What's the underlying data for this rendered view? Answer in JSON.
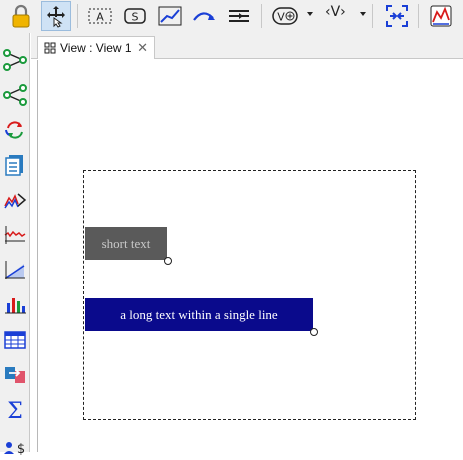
{
  "toolbar": {
    "buttons": [
      {
        "icon": "lock-icon"
      },
      {
        "icon": "move-graphics-icon",
        "active": true
      },
      {
        "icon": "text-box-icon",
        "label": "A"
      },
      {
        "icon": "slider-icon",
        "label": "S"
      },
      {
        "icon": "line-graph-icon"
      },
      {
        "icon": "curved-arrow-icon"
      },
      {
        "icon": "align-lines-icon"
      },
      {
        "icon": "add-variable-icon",
        "label": "V"
      },
      {
        "icon": "variable-brackets-icon",
        "label": "‹V›"
      },
      {
        "icon": "fit-view-icon"
      },
      {
        "icon": "graphics-view-icon"
      }
    ]
  },
  "sidebar": {
    "items": [
      {
        "icon": "graph-icon"
      },
      {
        "icon": "network-icon"
      },
      {
        "icon": "refresh-cycle-icon"
      },
      {
        "icon": "document-list-icon"
      },
      {
        "icon": "histogram-compare-icon"
      },
      {
        "icon": "time-series-icon"
      },
      {
        "icon": "area-chart-icon"
      },
      {
        "icon": "bar-chart-icon"
      },
      {
        "icon": "table-icon"
      },
      {
        "icon": "transfer-icon"
      },
      {
        "icon": "sigma-icon"
      },
      {
        "icon": "user-dollar-icon"
      }
    ]
  },
  "tab": {
    "label": "View : View 1",
    "close": "✕"
  },
  "canvas": {
    "short_text": "short text",
    "long_text": "a long text within a single line"
  },
  "colors": {
    "short_text_bg": "#5a5a5a",
    "long_text_bg": "#0a0a8c",
    "active_tool": "#cfe2f5"
  }
}
